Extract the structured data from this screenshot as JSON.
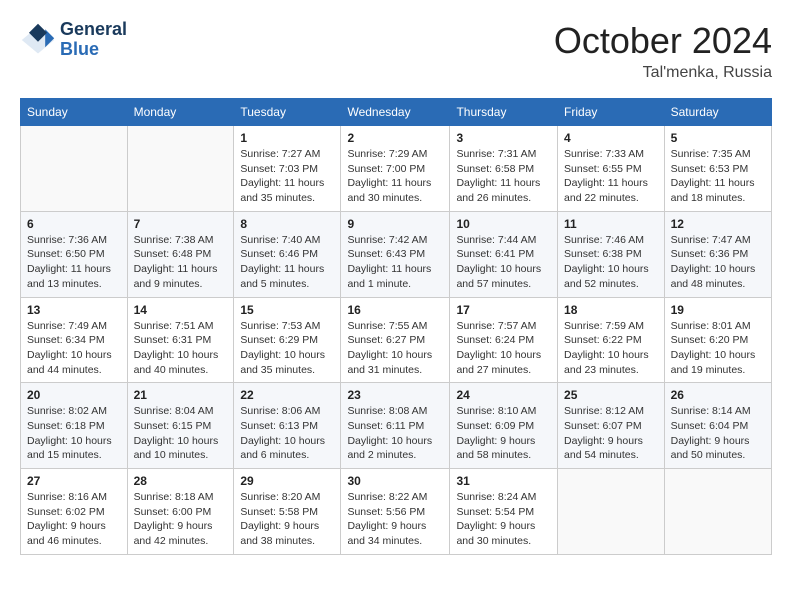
{
  "logo": {
    "line1": "General",
    "line2": "Blue"
  },
  "title": "October 2024",
  "location": "Tal'menka, Russia",
  "weekdays": [
    "Sunday",
    "Monday",
    "Tuesday",
    "Wednesday",
    "Thursday",
    "Friday",
    "Saturday"
  ],
  "weeks": [
    [
      {
        "day": "",
        "info": ""
      },
      {
        "day": "",
        "info": ""
      },
      {
        "day": "1",
        "info": "Sunrise: 7:27 AM\nSunset: 7:03 PM\nDaylight: 11 hours and 35 minutes."
      },
      {
        "day": "2",
        "info": "Sunrise: 7:29 AM\nSunset: 7:00 PM\nDaylight: 11 hours and 30 minutes."
      },
      {
        "day": "3",
        "info": "Sunrise: 7:31 AM\nSunset: 6:58 PM\nDaylight: 11 hours and 26 minutes."
      },
      {
        "day": "4",
        "info": "Sunrise: 7:33 AM\nSunset: 6:55 PM\nDaylight: 11 hours and 22 minutes."
      },
      {
        "day": "5",
        "info": "Sunrise: 7:35 AM\nSunset: 6:53 PM\nDaylight: 11 hours and 18 minutes."
      }
    ],
    [
      {
        "day": "6",
        "info": "Sunrise: 7:36 AM\nSunset: 6:50 PM\nDaylight: 11 hours and 13 minutes."
      },
      {
        "day": "7",
        "info": "Sunrise: 7:38 AM\nSunset: 6:48 PM\nDaylight: 11 hours and 9 minutes."
      },
      {
        "day": "8",
        "info": "Sunrise: 7:40 AM\nSunset: 6:46 PM\nDaylight: 11 hours and 5 minutes."
      },
      {
        "day": "9",
        "info": "Sunrise: 7:42 AM\nSunset: 6:43 PM\nDaylight: 11 hours and 1 minute."
      },
      {
        "day": "10",
        "info": "Sunrise: 7:44 AM\nSunset: 6:41 PM\nDaylight: 10 hours and 57 minutes."
      },
      {
        "day": "11",
        "info": "Sunrise: 7:46 AM\nSunset: 6:38 PM\nDaylight: 10 hours and 52 minutes."
      },
      {
        "day": "12",
        "info": "Sunrise: 7:47 AM\nSunset: 6:36 PM\nDaylight: 10 hours and 48 minutes."
      }
    ],
    [
      {
        "day": "13",
        "info": "Sunrise: 7:49 AM\nSunset: 6:34 PM\nDaylight: 10 hours and 44 minutes."
      },
      {
        "day": "14",
        "info": "Sunrise: 7:51 AM\nSunset: 6:31 PM\nDaylight: 10 hours and 40 minutes."
      },
      {
        "day": "15",
        "info": "Sunrise: 7:53 AM\nSunset: 6:29 PM\nDaylight: 10 hours and 35 minutes."
      },
      {
        "day": "16",
        "info": "Sunrise: 7:55 AM\nSunset: 6:27 PM\nDaylight: 10 hours and 31 minutes."
      },
      {
        "day": "17",
        "info": "Sunrise: 7:57 AM\nSunset: 6:24 PM\nDaylight: 10 hours and 27 minutes."
      },
      {
        "day": "18",
        "info": "Sunrise: 7:59 AM\nSunset: 6:22 PM\nDaylight: 10 hours and 23 minutes."
      },
      {
        "day": "19",
        "info": "Sunrise: 8:01 AM\nSunset: 6:20 PM\nDaylight: 10 hours and 19 minutes."
      }
    ],
    [
      {
        "day": "20",
        "info": "Sunrise: 8:02 AM\nSunset: 6:18 PM\nDaylight: 10 hours and 15 minutes."
      },
      {
        "day": "21",
        "info": "Sunrise: 8:04 AM\nSunset: 6:15 PM\nDaylight: 10 hours and 10 minutes."
      },
      {
        "day": "22",
        "info": "Sunrise: 8:06 AM\nSunset: 6:13 PM\nDaylight: 10 hours and 6 minutes."
      },
      {
        "day": "23",
        "info": "Sunrise: 8:08 AM\nSunset: 6:11 PM\nDaylight: 10 hours and 2 minutes."
      },
      {
        "day": "24",
        "info": "Sunrise: 8:10 AM\nSunset: 6:09 PM\nDaylight: 9 hours and 58 minutes."
      },
      {
        "day": "25",
        "info": "Sunrise: 8:12 AM\nSunset: 6:07 PM\nDaylight: 9 hours and 54 minutes."
      },
      {
        "day": "26",
        "info": "Sunrise: 8:14 AM\nSunset: 6:04 PM\nDaylight: 9 hours and 50 minutes."
      }
    ],
    [
      {
        "day": "27",
        "info": "Sunrise: 8:16 AM\nSunset: 6:02 PM\nDaylight: 9 hours and 46 minutes."
      },
      {
        "day": "28",
        "info": "Sunrise: 8:18 AM\nSunset: 6:00 PM\nDaylight: 9 hours and 42 minutes."
      },
      {
        "day": "29",
        "info": "Sunrise: 8:20 AM\nSunset: 5:58 PM\nDaylight: 9 hours and 38 minutes."
      },
      {
        "day": "30",
        "info": "Sunrise: 8:22 AM\nSunset: 5:56 PM\nDaylight: 9 hours and 34 minutes."
      },
      {
        "day": "31",
        "info": "Sunrise: 8:24 AM\nSunset: 5:54 PM\nDaylight: 9 hours and 30 minutes."
      },
      {
        "day": "",
        "info": ""
      },
      {
        "day": "",
        "info": ""
      }
    ]
  ]
}
